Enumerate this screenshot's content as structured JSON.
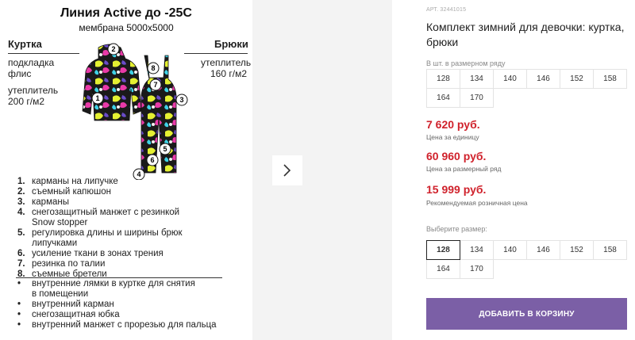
{
  "image": {
    "title": "Линия Active до -25С",
    "subtitle": "мембрана 5000х5000",
    "jacket_header": "Куртка",
    "pants_header": "Брюки",
    "jacket_specs": [
      "подкладка",
      "флис",
      "утеплитель",
      "200 г/м2"
    ],
    "pants_specs": [
      "утеплитель",
      "160 г/м2"
    ],
    "callouts": [
      "1",
      "2",
      "3",
      "4",
      "5",
      "6",
      "7",
      "8"
    ],
    "numbered_features": [
      {
        "num": "1.",
        "text": "карманы на липучке"
      },
      {
        "num": "2.",
        "text": "съемный капюшон"
      },
      {
        "num": "3.",
        "text": "карманы"
      },
      {
        "num": "4.",
        "text": "снегозащитный манжет с резинкой"
      },
      {
        "num": "",
        "text": "Snow stopper"
      },
      {
        "num": "5.",
        "text": "регулировка длины и ширины брюк"
      },
      {
        "num": "",
        "text": "липучками"
      },
      {
        "num": "6.",
        "text": "усиление ткани в зонах трения"
      },
      {
        "num": "7.",
        "text": "резинка по талии"
      },
      {
        "num": "8.",
        "text": "съемные бретели"
      }
    ],
    "bullet_features": [
      {
        "dot": "•",
        "text": "внутренние лямки в куртке для снятия"
      },
      {
        "dot": "",
        "text": "в помещении"
      },
      {
        "dot": "•",
        "text": "внутренний карман"
      },
      {
        "dot": "•",
        "text": "снегозащитная юбка"
      },
      {
        "dot": "•",
        "text": "внутренний манжет с прорезью для пальца"
      }
    ]
  },
  "gallery": {
    "next_icon": "chevron-right-icon"
  },
  "product": {
    "article": "АРТ. 32441015",
    "title": "Комплект зимний для девочки: куртка, брюки",
    "row_label": "В шт. в размерном ряду",
    "row_sizes": [
      "128",
      "134",
      "140",
      "146",
      "152",
      "158",
      "164",
      "170"
    ],
    "prices": [
      {
        "value": "7 620 руб.",
        "note": "Цена за единицу"
      },
      {
        "value": "60 960 руб.",
        "note": "Цена за размерный ряд"
      },
      {
        "value": "15 999 руб.",
        "note": "Рекомендуемая розничная цена"
      }
    ],
    "select_label": "Выберите размер:",
    "select_sizes": [
      "128",
      "134",
      "140",
      "146",
      "152",
      "158",
      "164",
      "170"
    ],
    "selected_size": "128",
    "add_to_cart": "ДОБАВИТЬ В КОРЗИНУ",
    "accent_color": "#7b5fa6",
    "price_color": "#d0222c"
  }
}
